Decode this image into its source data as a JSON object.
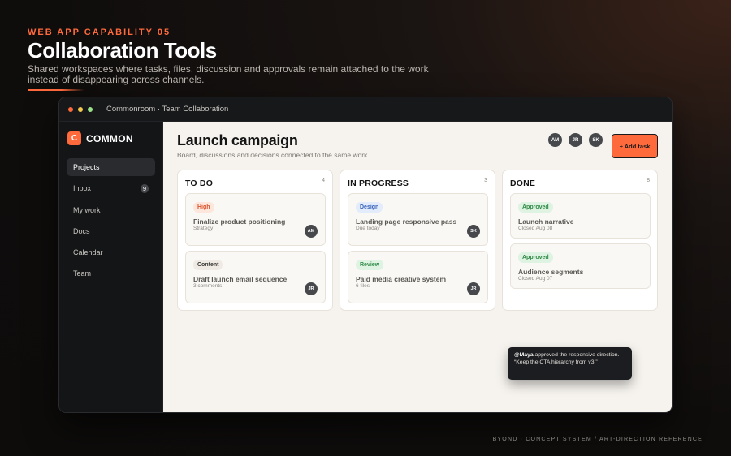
{
  "hero": {
    "eyebrow": "WEB APP CAPABILITY 05",
    "title": "Collaboration Tools",
    "description": "Shared workspaces where tasks, files, discussion and approvals remain attached to the work instead of disappearing across channels."
  },
  "window": {
    "title": "Commonroom · Team Collaboration"
  },
  "brand": {
    "mark": "C",
    "name": "COMMON"
  },
  "sidebar": {
    "items": [
      {
        "label": "Projects",
        "active": true
      },
      {
        "label": "Inbox",
        "badge": "9"
      },
      {
        "label": "My work"
      },
      {
        "label": "Docs"
      },
      {
        "label": "Calendar"
      },
      {
        "label": "Team"
      }
    ]
  },
  "main": {
    "title": "Launch campaign",
    "subtitle": "Board, discussions and decisions connected to the same work.",
    "avatars": [
      "AM",
      "JR",
      "SK"
    ],
    "add_task_label": "+ Add task"
  },
  "columns": [
    {
      "title": "TO DO",
      "count": "4",
      "cards": [
        {
          "tag": "High",
          "tag_type": "high",
          "title": "Finalize product positioning",
          "meta": "Strategy",
          "avatar": "AM"
        },
        {
          "tag": "Content",
          "tag_type": "content",
          "title": "Draft launch email sequence",
          "meta": "3 comments",
          "avatar": "JR"
        }
      ]
    },
    {
      "title": "IN PROGRESS",
      "count": "3",
      "cards": [
        {
          "tag": "Design",
          "tag_type": "design",
          "title": "Landing page responsive pass",
          "meta": "Due today",
          "avatar": "SK"
        },
        {
          "tag": "Review",
          "tag_type": "review",
          "title": "Paid media creative system",
          "meta": "6 files",
          "avatar": "JR"
        }
      ]
    },
    {
      "title": "DONE",
      "count": "8",
      "cards": [
        {
          "tag": "Approved",
          "tag_type": "approved",
          "title": "Launch narrative",
          "meta": "Closed Aug 08"
        },
        {
          "tag": "Approved",
          "tag_type": "approved",
          "title": "Audience segments",
          "meta": "Closed Aug 07"
        }
      ]
    }
  ],
  "toast": {
    "user": "@Maya",
    "message": " approved the responsive direction.",
    "quote": "“Keep the CTA hierarchy from v3.”"
  },
  "footer": {
    "text": "BYOND · CONCEPT SYSTEM / ART-DIRECTION REFERENCE"
  },
  "colors": {
    "accent": "#ff6a3d",
    "canvas": "#f6f3ee",
    "sidebar": "#141517"
  }
}
